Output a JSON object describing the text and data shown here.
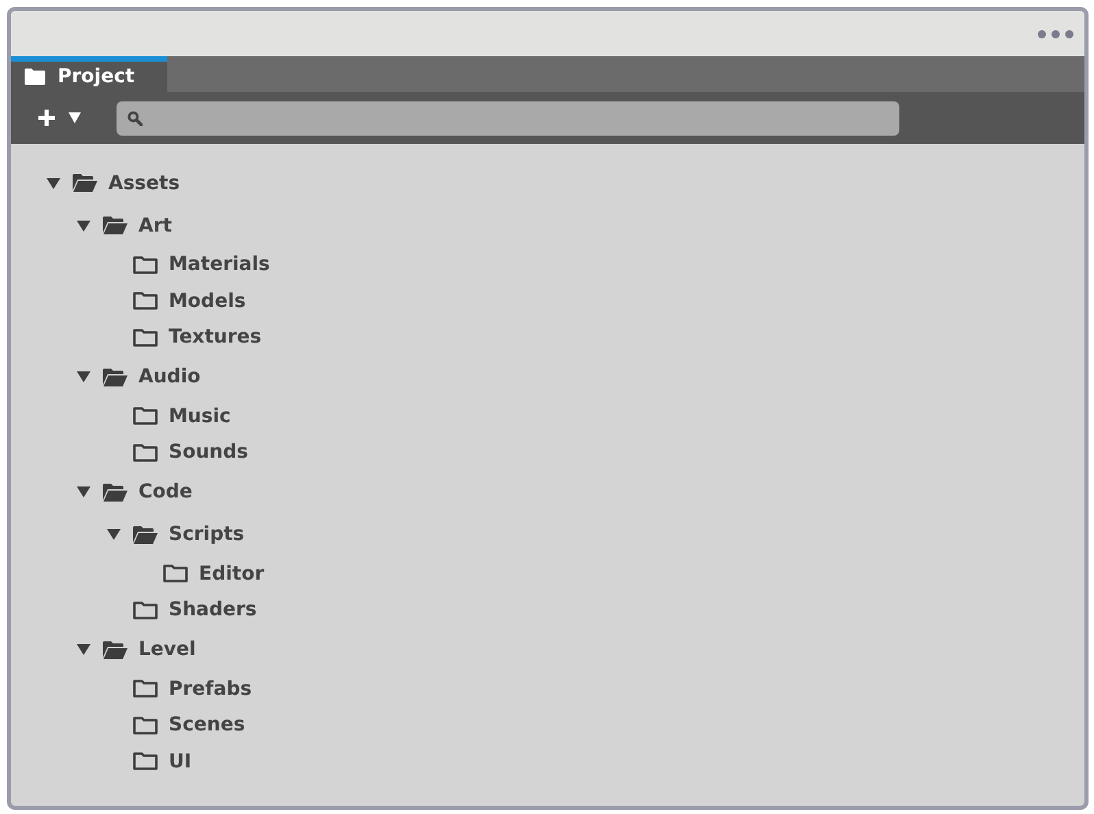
{
  "tab": {
    "label": "Project",
    "selected": true
  },
  "tree": [
    {
      "label": "Assets",
      "expanded": true,
      "children": [
        {
          "label": "Art",
          "expanded": true,
          "children": [
            {
              "label": "Materials"
            },
            {
              "label": "Models"
            },
            {
              "label": "Textures"
            }
          ]
        },
        {
          "label": "Audio",
          "expanded": true,
          "children": [
            {
              "label": "Music"
            },
            {
              "label": "Sounds"
            }
          ]
        },
        {
          "label": "Code",
          "expanded": true,
          "children": [
            {
              "label": "Scripts",
              "expanded": true,
              "children": [
                {
                  "label": "Editor"
                }
              ]
            },
            {
              "label": "Shaders"
            }
          ]
        },
        {
          "label": "Level",
          "expanded": true,
          "children": [
            {
              "label": "Prefabs"
            },
            {
              "label": "Scenes"
            },
            {
              "label": "UI"
            }
          ]
        }
      ]
    }
  ]
}
